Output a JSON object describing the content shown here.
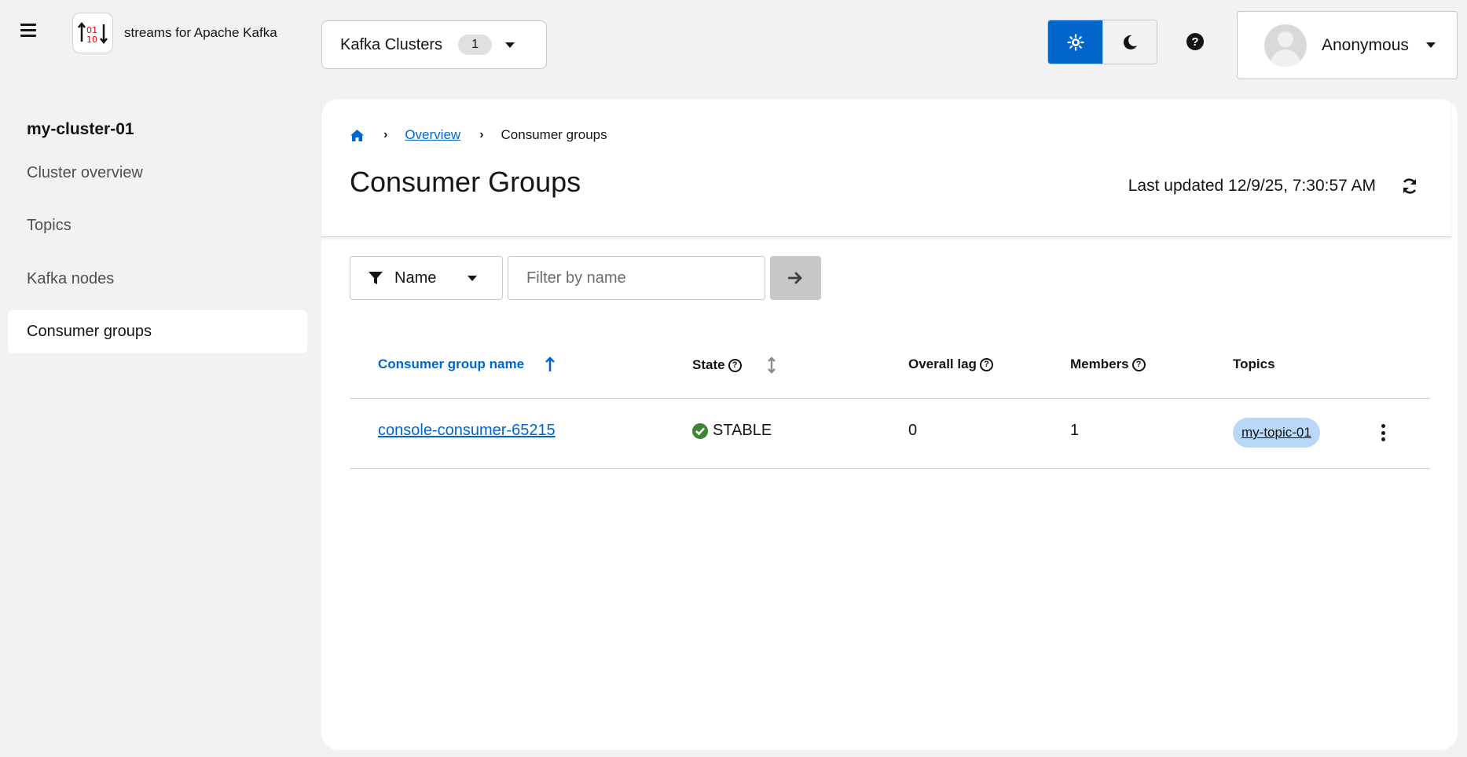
{
  "header": {
    "brand": "streams for Apache Kafka",
    "cluster_selector": {
      "label": "Kafka Clusters",
      "count": "1"
    },
    "theme": {
      "active": "light"
    },
    "help_label": "?",
    "user": {
      "name": "Anonymous"
    }
  },
  "sidebar": {
    "cluster_name": "my-cluster-01",
    "items": [
      {
        "label": "Cluster overview",
        "active": false
      },
      {
        "label": "Topics",
        "active": false
      },
      {
        "label": "Kafka nodes",
        "active": false
      },
      {
        "label": "Consumer groups",
        "active": true
      }
    ]
  },
  "breadcrumb": {
    "overview": "Overview",
    "current": "Consumer groups"
  },
  "page": {
    "title": "Consumer Groups",
    "last_updated": "Last updated 12/9/25, 7:30:57 AM"
  },
  "filter": {
    "attribute": "Name",
    "placeholder": "Filter by name",
    "value": ""
  },
  "table": {
    "columns": {
      "name": "Consumer group name",
      "state": "State",
      "lag": "Overall lag",
      "members": "Members",
      "topics": "Topics"
    },
    "rows": [
      {
        "name": "console-consumer-65215",
        "state": "STABLE",
        "lag": "0",
        "members": "1",
        "topics": [
          "my-topic-01"
        ]
      }
    ]
  },
  "colors": {
    "accent": "#0066cc",
    "success": "#3e8635",
    "chip": "#b9d8f8",
    "background": "#f2f2f2"
  }
}
